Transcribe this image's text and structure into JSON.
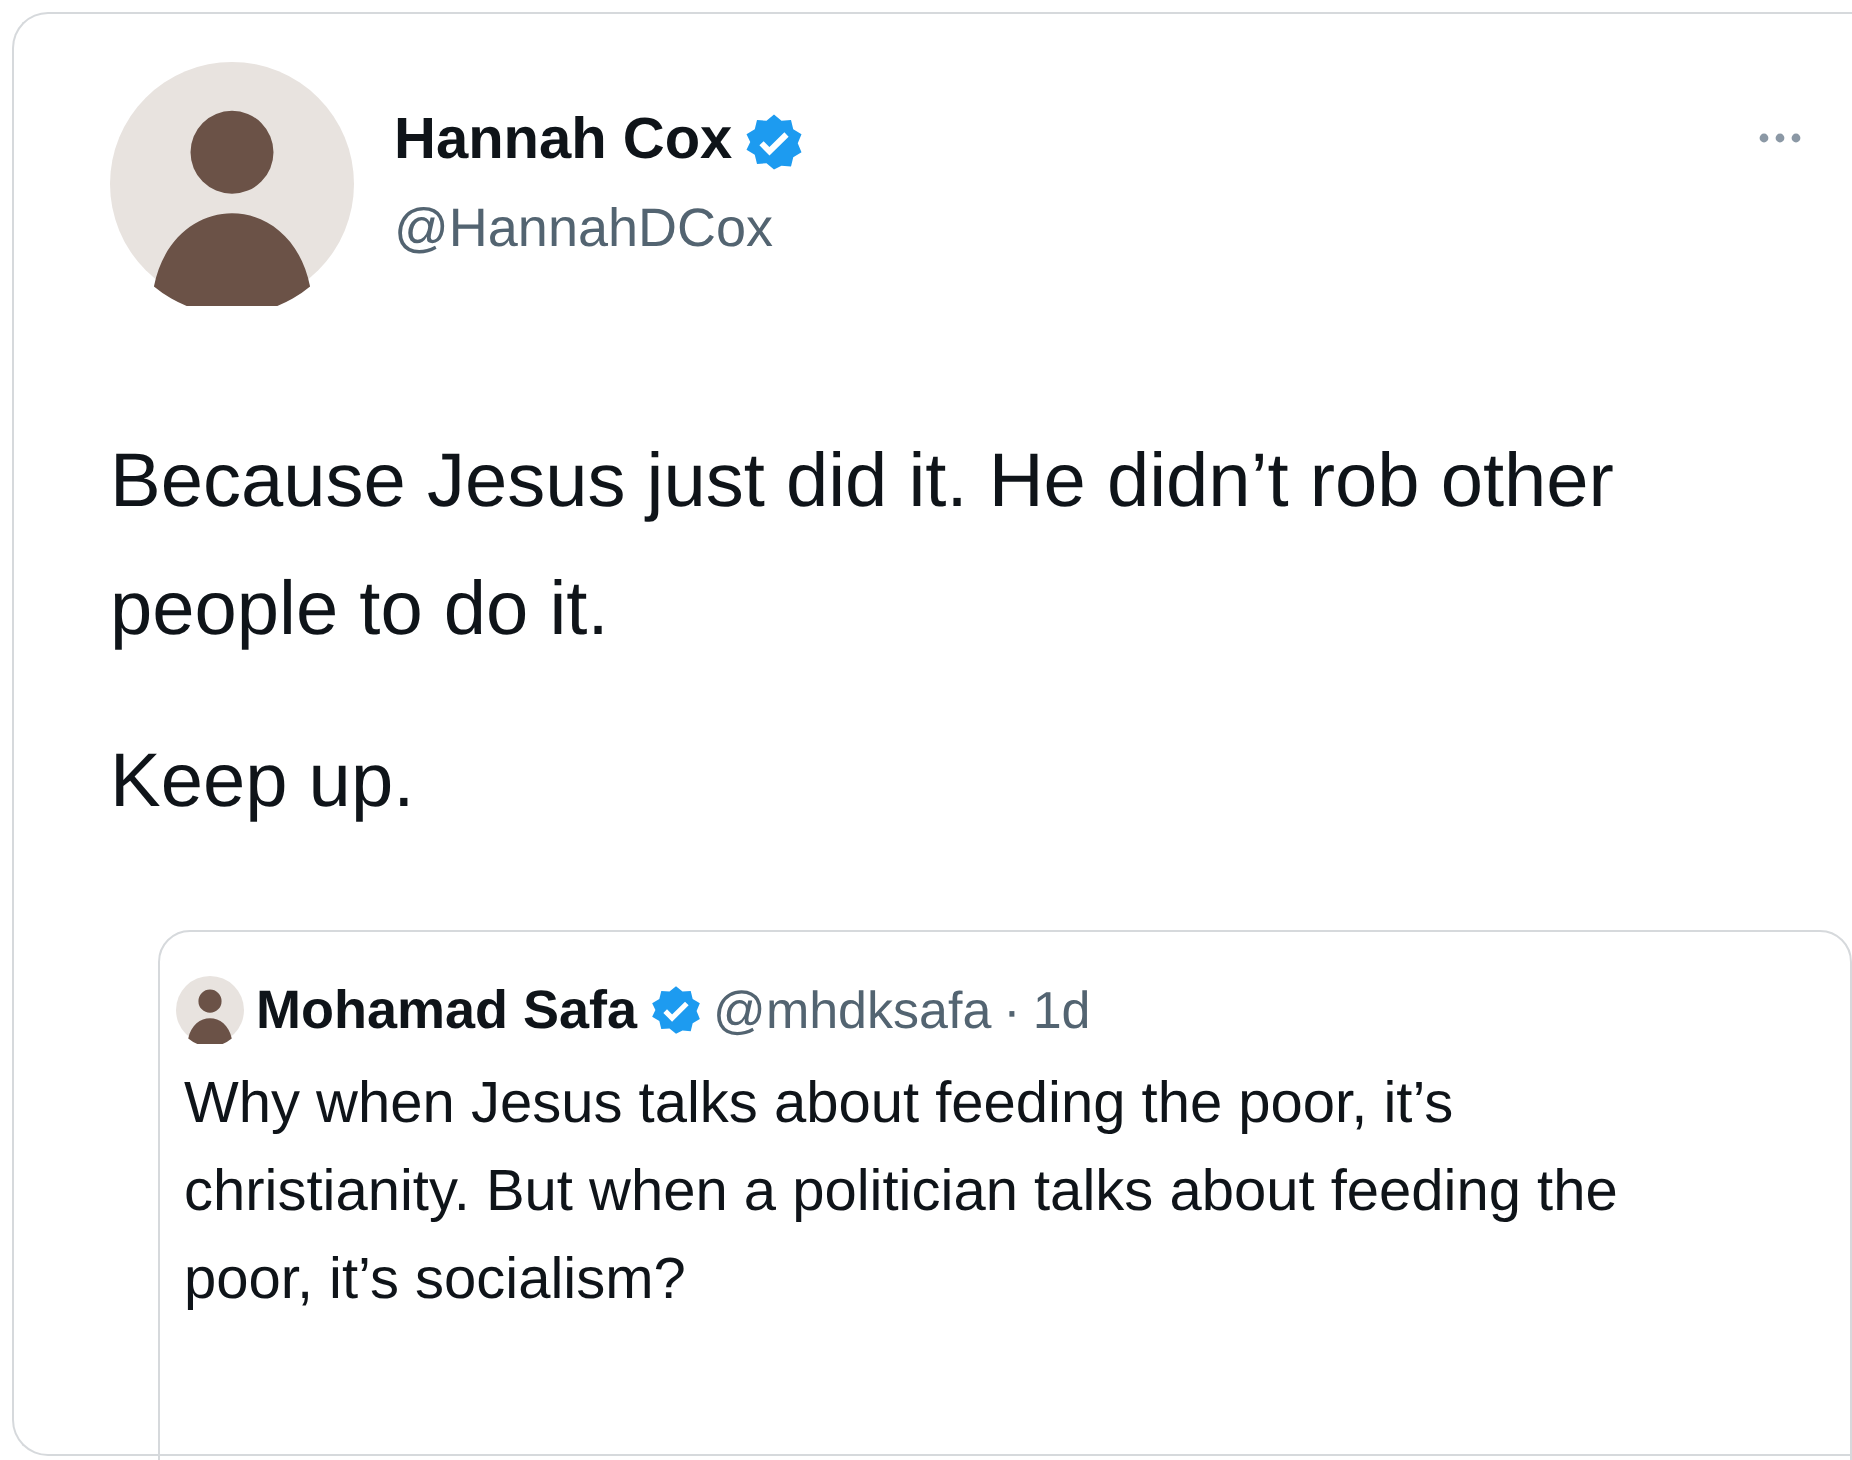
{
  "tweet": {
    "author": {
      "name": "Hannah Cox",
      "verified": true,
      "handle": "@HannahDCox"
    },
    "paragraphs": [
      "Because Jesus just did it. He didn’t rob other people to do it.",
      "Keep up."
    ],
    "quoted": {
      "author": {
        "name": "Mohamad Safa",
        "verified": true,
        "handle": "@mhdksafa",
        "separator": "·",
        "time": "1d"
      },
      "text": "Why when Jesus talks about feeding the poor, it’s christianity. But when a politician talks about feeding the poor, it’s socialism?"
    }
  }
}
